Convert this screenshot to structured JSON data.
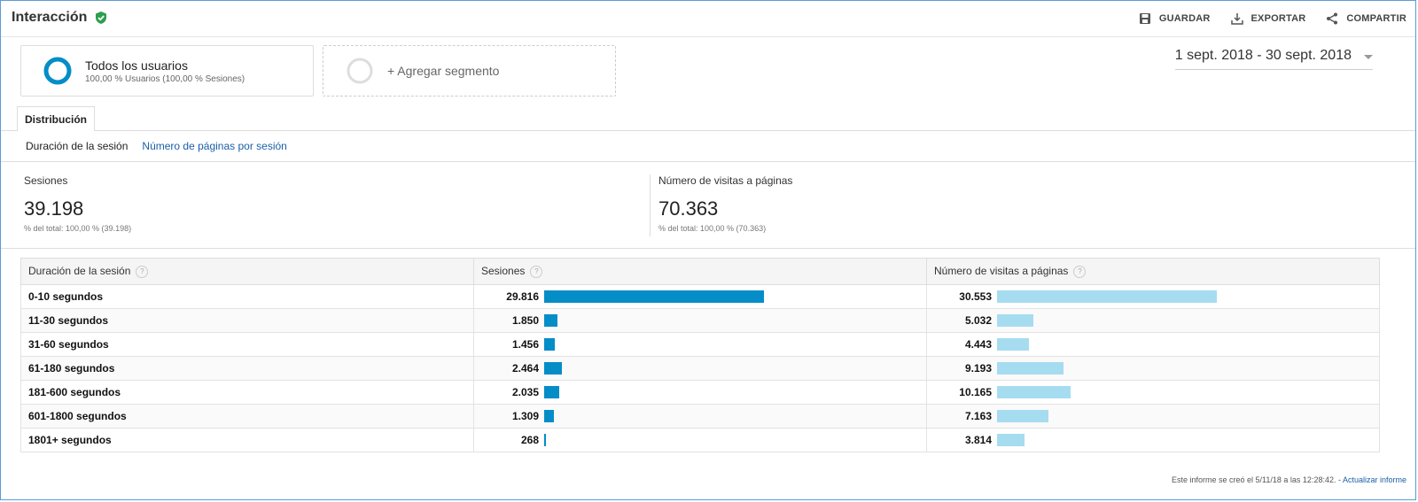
{
  "header": {
    "title": "Interacción",
    "actions": {
      "save": "GUARDAR",
      "export": "EXPORTAR",
      "share": "COMPARTIR"
    }
  },
  "segments": {
    "primary": {
      "name": "Todos los usuarios",
      "detail": "100,00 % Usuarios (100,00 % Sesiones)"
    },
    "add_label": "+ Agregar segmento"
  },
  "date_range": "1 sept. 2018 - 30 sept. 2018",
  "tabs": {
    "distribution": "Distribución"
  },
  "subnav": {
    "active": "Duración de la sesión",
    "link": "Número de páginas por sesión"
  },
  "metrics": {
    "sessions": {
      "label": "Sesiones",
      "value": "39.198",
      "note": "% del total: 100,00 % (39.198)"
    },
    "pageviews": {
      "label": "Número de visitas a páginas",
      "value": "70.363",
      "note": "% del total: 100,00 % (70.363)"
    }
  },
  "table": {
    "columns": [
      "Duración de la sesión",
      "Sesiones",
      "Número de visitas a páginas"
    ],
    "max_sessions": 29816,
    "max_pageviews": 30553,
    "rows": [
      {
        "label": "0-10 segundos",
        "sessions": "29.816",
        "sessions_n": 29816,
        "pageviews": "30.553",
        "pageviews_n": 30553
      },
      {
        "label": "11-30 segundos",
        "sessions": "1.850",
        "sessions_n": 1850,
        "pageviews": "5.032",
        "pageviews_n": 5032
      },
      {
        "label": "31-60 segundos",
        "sessions": "1.456",
        "sessions_n": 1456,
        "pageviews": "4.443",
        "pageviews_n": 4443
      },
      {
        "label": "61-180 segundos",
        "sessions": "2.464",
        "sessions_n": 2464,
        "pageviews": "9.193",
        "pageviews_n": 9193
      },
      {
        "label": "181-600 segundos",
        "sessions": "2.035",
        "sessions_n": 2035,
        "pageviews": "10.165",
        "pageviews_n": 10165
      },
      {
        "label": "601-1800 segundos",
        "sessions": "1.309",
        "sessions_n": 1309,
        "pageviews": "7.163",
        "pageviews_n": 7163
      },
      {
        "label": "1801+ segundos",
        "sessions": "268",
        "sessions_n": 268,
        "pageviews": "3.814",
        "pageviews_n": 3814
      }
    ]
  },
  "footer": {
    "text": "Este informe se creó el 5/11/18 a las 12:28:42. - ",
    "link": "Actualizar informe"
  },
  "colors": {
    "sessions_bar": "#058dc7",
    "pageviews_bar": "#a6dcf0",
    "verified": "#2e9e4f",
    "link": "#1a5fa8"
  }
}
